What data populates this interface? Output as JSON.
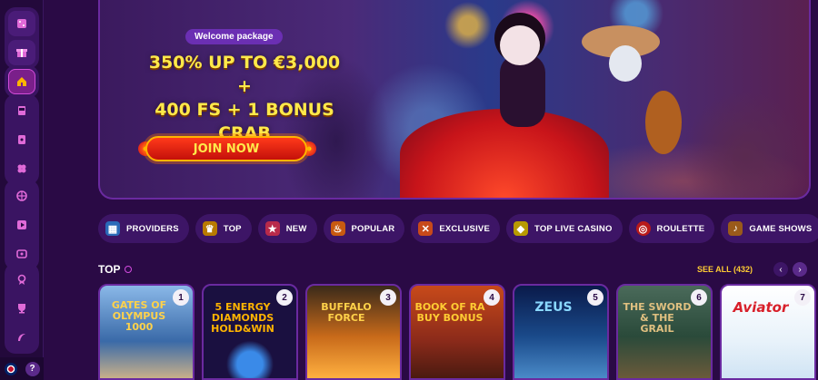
{
  "sidebar": {
    "items": [
      {
        "icon": "dice-icon",
        "active": false
      },
      {
        "icon": "gift-icon",
        "active": false
      },
      {
        "icon": "home-icon",
        "active": true
      },
      {
        "icon": "slot-machine-icon",
        "active": false
      },
      {
        "icon": "cards-icon",
        "active": false
      },
      {
        "icon": "clover-icon",
        "active": false
      },
      {
        "icon": "basketball-icon",
        "active": false
      },
      {
        "icon": "play-icon",
        "active": false
      },
      {
        "icon": "live-tv-icon",
        "active": false
      },
      {
        "icon": "trophy-ribbon-icon",
        "active": false
      },
      {
        "icon": "cup-icon",
        "active": false
      },
      {
        "icon": "boomerang-icon",
        "active": false
      }
    ],
    "help_label": "?"
  },
  "banner": {
    "tag": "Welcome package",
    "headline_lines": [
      "350% UP TO €3,000 +",
      "400 FS + 1 BONUS",
      "CRAB"
    ],
    "cta": "JOIN NOW"
  },
  "categories": [
    {
      "label": "PROVIDERS",
      "icon": "providers-icon",
      "color": "#5ab0ff"
    },
    {
      "label": "TOP",
      "icon": "trophy-icon",
      "color": "#ffb400"
    },
    {
      "label": "NEW",
      "icon": "new-icon",
      "color": "#ff4a6a"
    },
    {
      "label": "POPULAR",
      "icon": "popular-icon",
      "color": "#ff8a1a"
    },
    {
      "label": "EXCLUSIVE",
      "icon": "maracas-icon",
      "color": "#ff6a2a"
    },
    {
      "label": "TOP LIVE CASINO",
      "icon": "live-casino-icon",
      "color": "#ffcc00"
    },
    {
      "label": "ROULETTE",
      "icon": "roulette-icon",
      "color": "#ff3a3a"
    },
    {
      "label": "GAME SHOWS",
      "icon": "guitar-icon",
      "color": "#ffaa44"
    }
  ],
  "top_section": {
    "title": "TOP",
    "see_all": "SEE ALL (432)",
    "prev": "‹",
    "next": "›"
  },
  "games": [
    {
      "rank": "1",
      "title": "GATES OF OLYMPUS 1000",
      "bg": "#5a8ac8",
      "accent": "#ffd24a"
    },
    {
      "rank": "2",
      "title": "5 ENERGY DIAMONDS HOLD&WIN",
      "bg": "#1a1040",
      "accent": "#ffb400"
    },
    {
      "rank": "3",
      "title": "BUFFALO FORCE",
      "bg": "#c86a1a",
      "accent": "#ffd24a"
    },
    {
      "rank": "4",
      "title": "BOOK OF RA BUY BONUS",
      "bg": "#8a2a1a",
      "accent": "#ffcc33"
    },
    {
      "rank": "5",
      "title": "ZEUS",
      "bg": "#1a4a8a",
      "accent": "#8ad8ff"
    },
    {
      "rank": "6",
      "title": "THE SWORD & THE GRAIL",
      "bg": "#2a4a3a",
      "accent": "#e0c080"
    },
    {
      "rank": "7",
      "title": "Aviator",
      "bg": "#e8f2fa",
      "accent": "#d8202a"
    }
  ]
}
